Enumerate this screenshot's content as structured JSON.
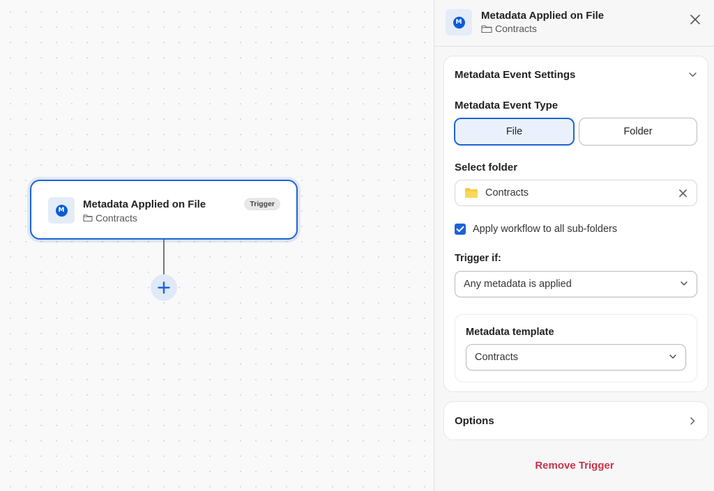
{
  "node": {
    "title": "Metadata Applied on File",
    "folder": "Contracts",
    "badge": "Trigger",
    "icon_letter": "M",
    "icon": "box-metadata-icon"
  },
  "panel": {
    "header": {
      "title": "Metadata Applied on File",
      "folder": "Contracts",
      "icon_letter": "M"
    },
    "settings": {
      "title": "Metadata Event Settings",
      "event_type_label": "Metadata Event Type",
      "event_type_options": [
        "File",
        "Folder"
      ],
      "event_type_selected": "File",
      "select_folder_label": "Select folder",
      "selected_folder": "Contracts",
      "apply_subfolders_label": "Apply workflow to all sub-folders",
      "apply_subfolders_checked": true,
      "trigger_if_label": "Trigger if:",
      "trigger_if_value": "Any metadata is applied",
      "template_label": "Metadata template",
      "template_value": "Contracts"
    },
    "options_label": "Options",
    "remove_label": "Remove Trigger"
  },
  "colors": {
    "accent": "#1d63d6",
    "danger": "#c8324b",
    "folder_yellow": "#f5c842"
  }
}
